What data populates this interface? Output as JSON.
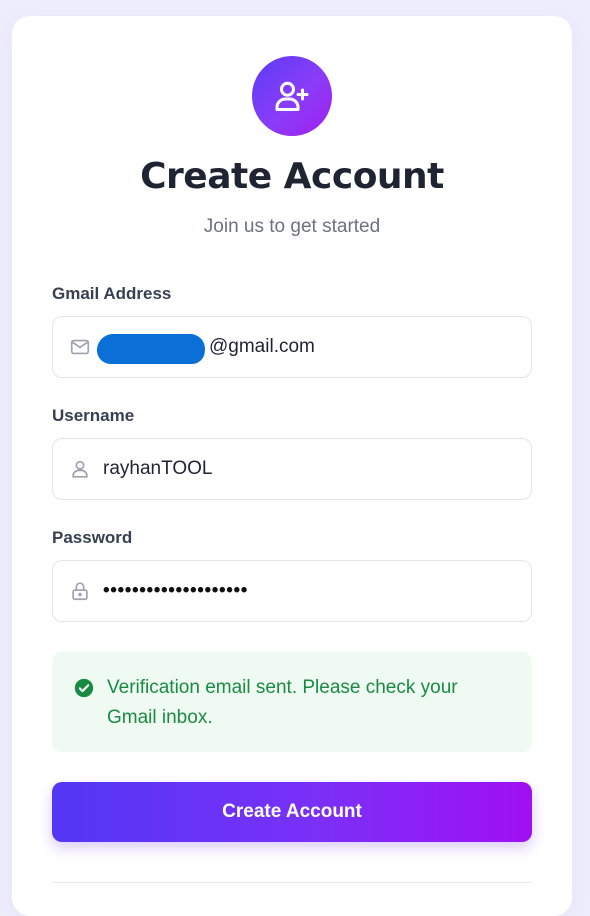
{
  "header": {
    "icon": "user-plus-icon",
    "title": "Create Account",
    "subtitle": "Join us to get started"
  },
  "form": {
    "email": {
      "label": "Gmail Address",
      "icon": "mail-icon",
      "value_suffix": "@gmail.com",
      "redacted": true
    },
    "username": {
      "label": "Username",
      "icon": "user-icon",
      "value": "rayhanTOOL"
    },
    "password": {
      "label": "Password",
      "icon": "lock-icon",
      "value_masked": "••••••••••••••••••••"
    }
  },
  "alert": {
    "type": "success",
    "icon": "check-circle-icon",
    "message": "Verification email sent. Please check your Gmail inbox."
  },
  "submit": {
    "label": "Create Account"
  },
  "colors": {
    "accent_start": "#5237f5",
    "accent_end": "#a10ff3",
    "success_text": "#1a8a43",
    "success_bg": "#effbf2",
    "page_bg": "#eeedfc"
  }
}
